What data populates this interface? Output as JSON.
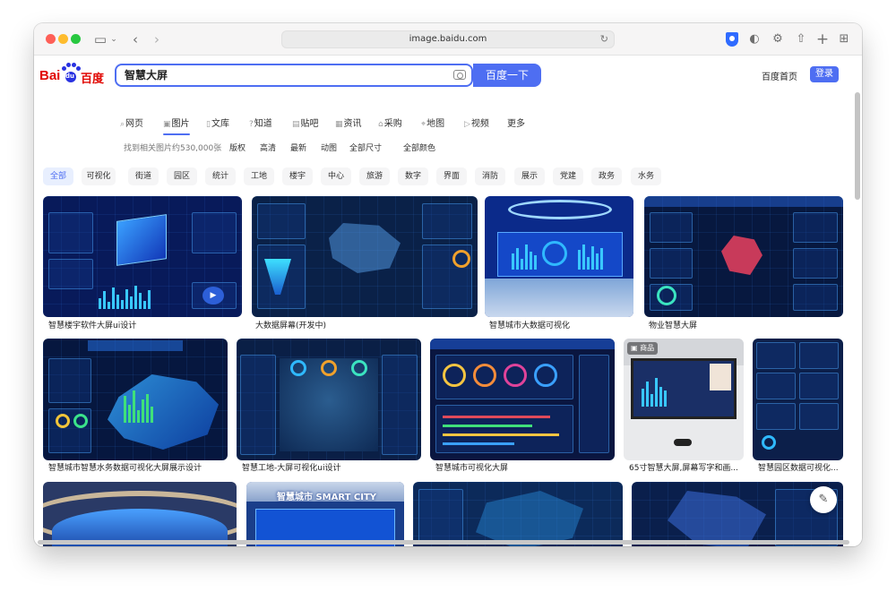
{
  "browser": {
    "url": "image.baidu.com",
    "icons": [
      "sidebar-icon",
      "chevron-down-icon",
      "back-icon",
      "forward-icon",
      "reload-icon",
      "shield-icon",
      "half-circle-icon",
      "gear-icon",
      "share-icon",
      "plus-icon",
      "grid-icon"
    ]
  },
  "header": {
    "logo_latin": "Bai",
    "logo_du": "du",
    "logo_cn": "百度",
    "search_value": "智慧大屏",
    "search_button": "百度一下",
    "home_link": "百度首页",
    "login_button": "登录"
  },
  "nav": {
    "items": [
      {
        "label": "网页",
        "icon": "search-icon"
      },
      {
        "label": "图片",
        "icon": "image-icon",
        "active": true
      },
      {
        "label": "文库",
        "icon": "doc-icon"
      },
      {
        "label": "知道",
        "icon": "question-icon"
      },
      {
        "label": "贴吧",
        "icon": "tieba-icon"
      },
      {
        "label": "资讯",
        "icon": "news-icon"
      },
      {
        "label": "采购",
        "icon": "cart-icon"
      },
      {
        "label": "地图",
        "icon": "map-icon"
      },
      {
        "label": "视频",
        "icon": "video-icon"
      },
      {
        "label": "更多",
        "icon": ""
      }
    ]
  },
  "filters": {
    "count_text": "找到相关图片约530,000张",
    "items": [
      "版权",
      "高清",
      "最新",
      "动图",
      "全部尺寸",
      "全部颜色"
    ]
  },
  "tags": [
    "全部",
    "可视化",
    "街道",
    "园区",
    "统计",
    "工地",
    "楼宇",
    "中心",
    "旅游",
    "数字",
    "界面",
    "消防",
    "展示",
    "党建",
    "政务",
    "水务"
  ],
  "results": {
    "row1": [
      {
        "caption": "智慧楼宇软件大屏ui设计"
      },
      {
        "caption": "大数据屏幕(开发中)"
      },
      {
        "caption": "智慧城市大数据可视化"
      },
      {
        "caption": "物业智慧大屏"
      }
    ],
    "row2": [
      {
        "caption": "智慧城市智慧水务数据可视化大屏展示设计"
      },
      {
        "caption": "智慧工地-大屏可视化ui设计"
      },
      {
        "caption": "智慧城市可视化大屏"
      },
      {
        "caption": "65寸智慧大屏,屏幕写字和画...",
        "badge": "商品"
      },
      {
        "caption": "智慧园区数据可视化..."
      }
    ],
    "row3_text": [
      "智慧城市 SMART CITY"
    ]
  },
  "colors": {
    "accent": "#4e6ef2",
    "baidu_red": "#e10601",
    "baidu_blue": "#2932e1"
  }
}
